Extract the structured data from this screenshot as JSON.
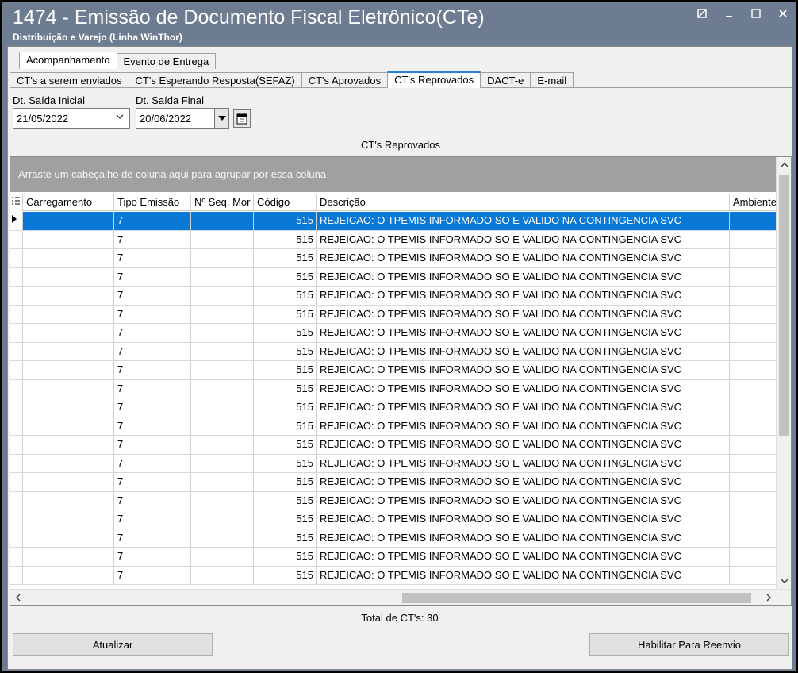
{
  "window": {
    "title": "1474 - Emissão de Documento Fiscal Eletrônico(CTe)",
    "subtitle": "Distribuição e Varejo (Linha WinThor)"
  },
  "top_tabs": [
    {
      "label": "Acompanhamento",
      "active": true
    },
    {
      "label": "Evento de Entrega",
      "active": false
    }
  ],
  "sub_tabs": [
    {
      "label": "CT's a serem enviados",
      "active": false
    },
    {
      "label": "CT's Esperando Resposta(SEFAZ)",
      "active": false
    },
    {
      "label": "CT's Aprovados",
      "active": false
    },
    {
      "label": "CT's Reprovados",
      "active": true
    },
    {
      "label": "DACT-e",
      "active": false
    },
    {
      "label": "E-mail",
      "active": false
    }
  ],
  "filters": {
    "start_label": "Dt. Saída Inicial",
    "start_value": "21/05/2022",
    "end_label": "Dt. Saída Final",
    "end_value": "20/06/2022"
  },
  "panel_title": "CT's Reprovados",
  "grid": {
    "group_hint": "Arraste um cabeçalho de coluna aqui para agrupar por essa coluna",
    "columns": [
      "Carregamento",
      "Tipo Emissão",
      "Nº Seq. Mor",
      "Código",
      "Descrição",
      "Ambiente"
    ],
    "rows": [
      [
        "",
        "7",
        "",
        "515",
        "REJEICAO: O TPEMIS INFORMADO SO E VALIDO NA CONTINGENCIA SVC",
        ""
      ],
      [
        "",
        "7",
        "",
        "515",
        "REJEICAO: O TPEMIS INFORMADO SO E VALIDO NA CONTINGENCIA SVC",
        ""
      ],
      [
        "",
        "7",
        "",
        "515",
        "REJEICAO: O TPEMIS INFORMADO SO E VALIDO NA CONTINGENCIA SVC",
        ""
      ],
      [
        "",
        "7",
        "",
        "515",
        "REJEICAO: O TPEMIS INFORMADO SO E VALIDO NA CONTINGENCIA SVC",
        ""
      ],
      [
        "",
        "7",
        "",
        "515",
        "REJEICAO: O TPEMIS INFORMADO SO E VALIDO NA CONTINGENCIA SVC",
        ""
      ],
      [
        "",
        "7",
        "",
        "515",
        "REJEICAO: O TPEMIS INFORMADO SO E VALIDO NA CONTINGENCIA SVC",
        ""
      ],
      [
        "",
        "7",
        "",
        "515",
        "REJEICAO: O TPEMIS INFORMADO SO E VALIDO NA CONTINGENCIA SVC",
        ""
      ],
      [
        "",
        "7",
        "",
        "515",
        "REJEICAO: O TPEMIS INFORMADO SO E VALIDO NA CONTINGENCIA SVC",
        ""
      ],
      [
        "",
        "7",
        "",
        "515",
        "REJEICAO: O TPEMIS INFORMADO SO E VALIDO NA CONTINGENCIA SVC",
        ""
      ],
      [
        "",
        "7",
        "",
        "515",
        "REJEICAO: O TPEMIS INFORMADO SO E VALIDO NA CONTINGENCIA SVC",
        ""
      ],
      [
        "",
        "7",
        "",
        "515",
        "REJEICAO: O TPEMIS INFORMADO SO E VALIDO NA CONTINGENCIA SVC",
        ""
      ],
      [
        "",
        "7",
        "",
        "515",
        "REJEICAO: O TPEMIS INFORMADO SO E VALIDO NA CONTINGENCIA SVC",
        ""
      ],
      [
        "",
        "7",
        "",
        "515",
        "REJEICAO: O TPEMIS INFORMADO SO E VALIDO NA CONTINGENCIA SVC",
        ""
      ],
      [
        "",
        "7",
        "",
        "515",
        "REJEICAO: O TPEMIS INFORMADO SO E VALIDO NA CONTINGENCIA SVC",
        ""
      ],
      [
        "",
        "7",
        "",
        "515",
        "REJEICAO: O TPEMIS INFORMADO SO E VALIDO NA CONTINGENCIA SVC",
        ""
      ],
      [
        "",
        "7",
        "",
        "515",
        "REJEICAO: O TPEMIS INFORMADO SO E VALIDO NA CONTINGENCIA SVC",
        ""
      ],
      [
        "",
        "7",
        "",
        "515",
        "REJEICAO: O TPEMIS INFORMADO SO E VALIDO NA CONTINGENCIA SVC",
        ""
      ],
      [
        "",
        "7",
        "",
        "515",
        "REJEICAO: O TPEMIS INFORMADO SO E VALIDO NA CONTINGENCIA SVC",
        ""
      ],
      [
        "",
        "7",
        "",
        "515",
        "REJEICAO: O TPEMIS INFORMADO SO E VALIDO NA CONTINGENCIA SVC",
        ""
      ],
      [
        "",
        "7",
        "",
        "515",
        "REJEICAO: O TPEMIS INFORMADO SO E VALIDO NA CONTINGENCIA SVC",
        ""
      ]
    ],
    "selected_row": 0
  },
  "total_label": "Total de CT's: 30",
  "buttons": {
    "refresh": "Atualizar",
    "resend": "Habilitar Para Reenvio"
  },
  "icons": {
    "window": [
      "restore-icon",
      "minimize-icon",
      "maximize-icon",
      "close-icon"
    ],
    "calendar": "calendar-icon",
    "dropdown": "chevron-down-icon"
  },
  "colors": {
    "title_bar": "#6d7c91",
    "selection": "#0a78d7",
    "active_tab_accent": "#2a82d3",
    "group_box": "#a0a0a0"
  }
}
